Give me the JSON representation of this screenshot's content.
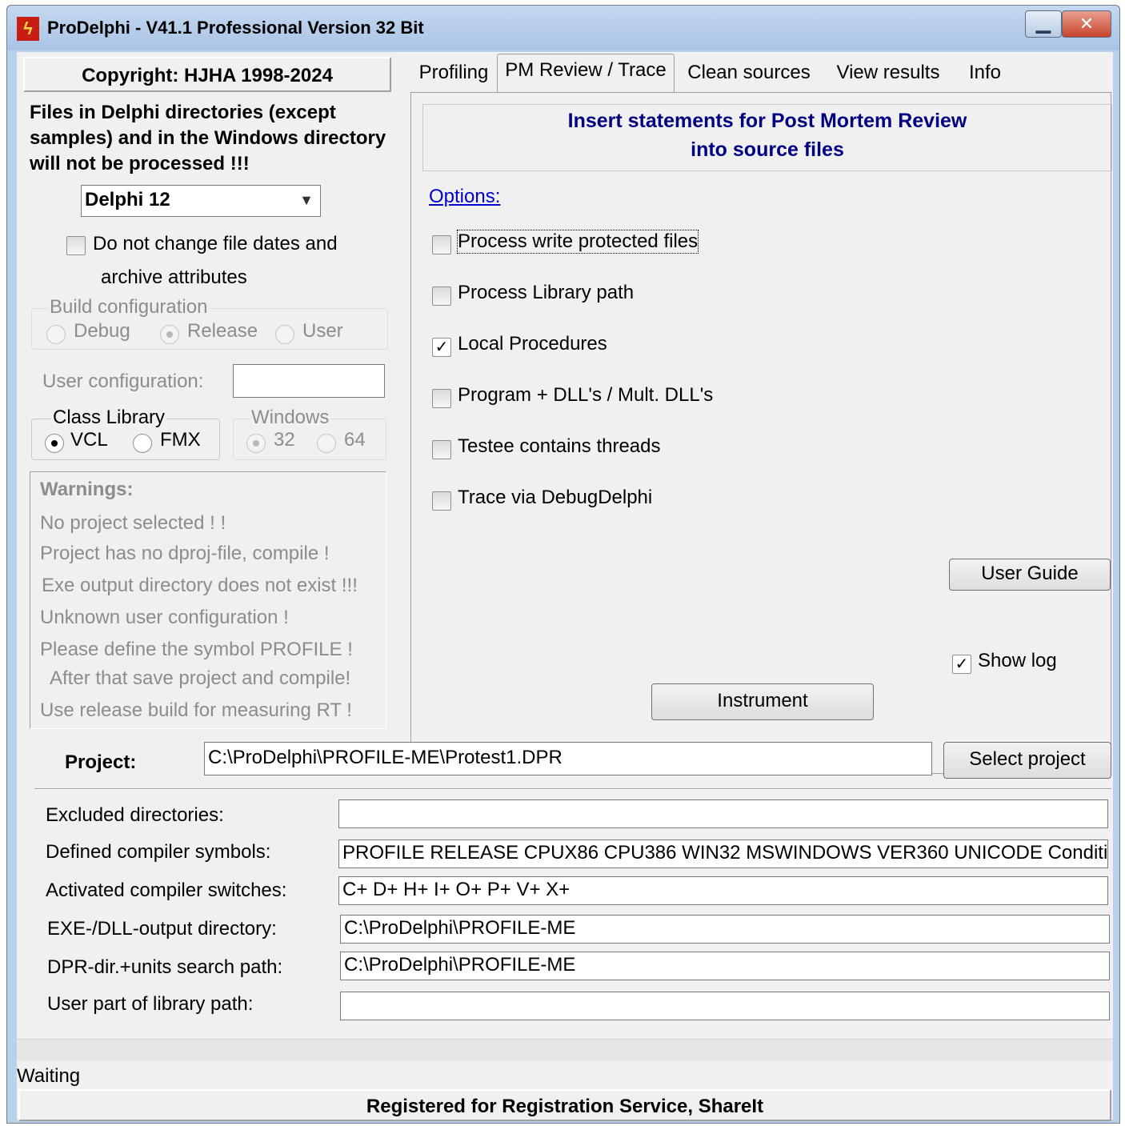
{
  "window": {
    "title": "ProDelphi - V41.1  Professional Version 32 Bit",
    "icon": "lightning-icon"
  },
  "left": {
    "copyright": "Copyright: HJHA 1998-2024",
    "notice_lines": [
      "Files in Delphi directories (except",
      "samples) and in the Windows directory",
      "will not be processed !!!"
    ],
    "delphi_version": "Delphi 12",
    "no_change_dates_line1": "Do not change file dates and",
    "no_change_dates_line2": "archive attributes",
    "build_config": {
      "title": "Build configuration",
      "options": [
        "Debug",
        "Release",
        "User"
      ],
      "selected": "Release"
    },
    "user_config_label": "User configuration:",
    "user_config_value": "",
    "class_library": {
      "title": "Class Library",
      "options": [
        "VCL",
        "FMX"
      ],
      "selected": "VCL"
    },
    "windows": {
      "title": "Windows",
      "options": [
        "32",
        "64"
      ],
      "selected": "32"
    },
    "warnings_title": "Warnings:",
    "warnings": [
      "No project selected ! !",
      "Project has no dproj-file, compile !",
      "Exe output directory does not exist !!!",
      "Unknown user configuration !",
      "Please define the symbol PROFILE !",
      "After that save project and compile!",
      "Use release build for measuring RT !"
    ]
  },
  "tabs": [
    "Profiling",
    "PM Review / Trace",
    "Clean sources",
    "View results",
    "Info"
  ],
  "active_tab": "PM Review / Trace",
  "panel": {
    "info_line1": "Insert statements for Post Mortem Review",
    "info_line2": "into source files",
    "options_label": "Options:",
    "options": [
      {
        "label": "Process write protected files",
        "checked": false
      },
      {
        "label": "Process Library path",
        "checked": false
      },
      {
        "label": "Local Procedures",
        "checked": true
      },
      {
        "label": "Program + DLL's / Mult. DLL's",
        "checked": false
      },
      {
        "label": "Testee contains threads",
        "checked": false
      },
      {
        "label": "Trace via DebugDelphi",
        "checked": false
      }
    ],
    "user_guide": "User Guide",
    "show_log": "Show log",
    "show_log_checked": true,
    "instrument": "Instrument"
  },
  "project": {
    "label": "Project:",
    "value": "C:\\ProDelphi\\PROFILE-ME\\Protest1.DPR",
    "select_button": "Select project"
  },
  "fields": {
    "excluded_label": "Excluded directories:",
    "excluded_value": "",
    "symbols_label": "Defined compiler symbols:",
    "symbols_value": "PROFILE RELEASE CPUX86 CPU386 WIN32 MSWINDOWS VER360 UNICODE Conditi",
    "switches_label": "Activated compiler switches:",
    "switches_value": "C+ D+ H+ I+ O+ P+ V+ X+",
    "exe_label": "EXE-/DLL-output directory:",
    "exe_value": "C:\\ProDelphi\\PROFILE-ME",
    "search_label": "DPR-dir.+units search path:",
    "search_value": "C:\\ProDelphi\\PROFILE-ME",
    "userlib_label": "User part of library path:",
    "userlib_value": ""
  },
  "status": "Waiting",
  "registered": "Registered for Registration Service, ShareIt"
}
